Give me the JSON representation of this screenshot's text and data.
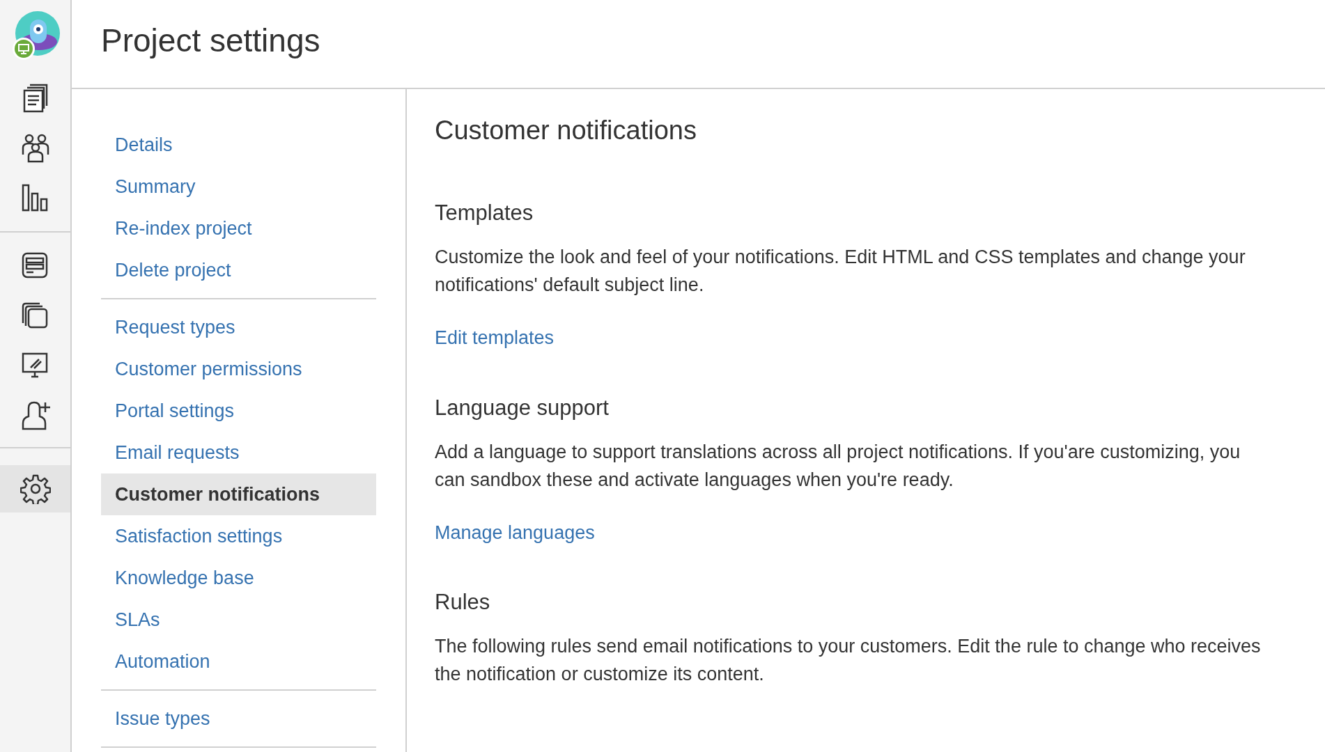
{
  "page_title": "Project settings",
  "rail": {
    "groups": [
      {
        "items": [
          {
            "kind": "queues",
            "selected": false
          },
          {
            "kind": "customers",
            "selected": false
          },
          {
            "kind": "reports",
            "selected": false
          }
        ]
      },
      {
        "items": [
          {
            "kind": "channels",
            "selected": false
          },
          {
            "kind": "knowledge",
            "selected": false
          },
          {
            "kind": "monitor",
            "selected": false
          },
          {
            "kind": "invite",
            "selected": false
          }
        ]
      },
      {
        "items": [
          {
            "kind": "settings",
            "selected": true
          }
        ]
      }
    ]
  },
  "nav": {
    "groups": [
      {
        "items": [
          {
            "label": "Details",
            "selected": false
          },
          {
            "label": "Summary",
            "selected": false
          },
          {
            "label": "Re-index project",
            "selected": false
          },
          {
            "label": "Delete project",
            "selected": false
          }
        ]
      },
      {
        "items": [
          {
            "label": "Request types",
            "selected": false
          },
          {
            "label": "Customer permissions",
            "selected": false
          },
          {
            "label": "Portal settings",
            "selected": false
          },
          {
            "label": "Email requests",
            "selected": false
          },
          {
            "label": "Customer notifications",
            "selected": true
          },
          {
            "label": "Satisfaction settings",
            "selected": false
          },
          {
            "label": "Knowledge base",
            "selected": false
          },
          {
            "label": "SLAs",
            "selected": false
          },
          {
            "label": "Automation",
            "selected": false
          }
        ]
      },
      {
        "items": [
          {
            "label": "Issue types",
            "selected": false
          }
        ]
      }
    ]
  },
  "content": {
    "title": "Customer notifications",
    "sections": [
      {
        "heading": "Templates",
        "text": "Customize the look and feel of your notifications. Edit HTML and CSS templates and change your notifications' default subject line.",
        "link": "Edit templates"
      },
      {
        "heading": "Language support",
        "text": "Add a language to support translations across all project notifications. If you'are customizing, you can sandbox these and activate languages when you're ready.",
        "link": "Manage languages"
      },
      {
        "heading": "Rules",
        "text": "The following rules send email notifications to your customers. Edit the rule to change who receives the notification or customize its content."
      }
    ]
  }
}
